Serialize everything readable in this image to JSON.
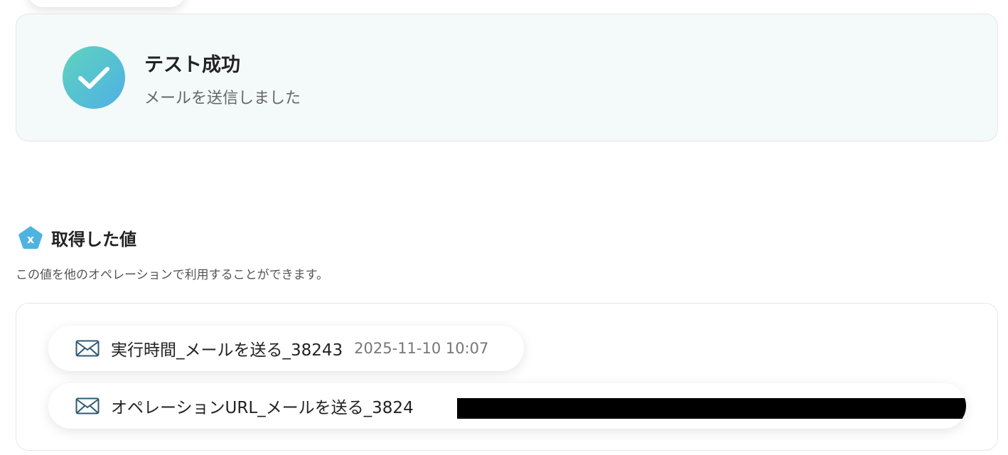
{
  "result": {
    "title": "テスト成功",
    "subtitle": "メールを送信しました",
    "icon": "check-circle-icon"
  },
  "values_section": {
    "title": "取得した値",
    "icon": "x-pentagon-icon",
    "description": "この値を他のオペレーションで利用することができます。",
    "items": [
      {
        "icon": "mail-icon",
        "label": "実行時間_メールを送る_38243",
        "value": "2025-11-10 10:07"
      },
      {
        "icon": "mail-icon",
        "label": "オペレーションURL_メールを送る_3824",
        "value": ""
      }
    ]
  },
  "colors": {
    "card_bg": "#f4f9f9",
    "check_gradient_start": "#5fd3bd",
    "check_gradient_end": "#4fb0e6",
    "section_icon": "#4fb3e0"
  }
}
